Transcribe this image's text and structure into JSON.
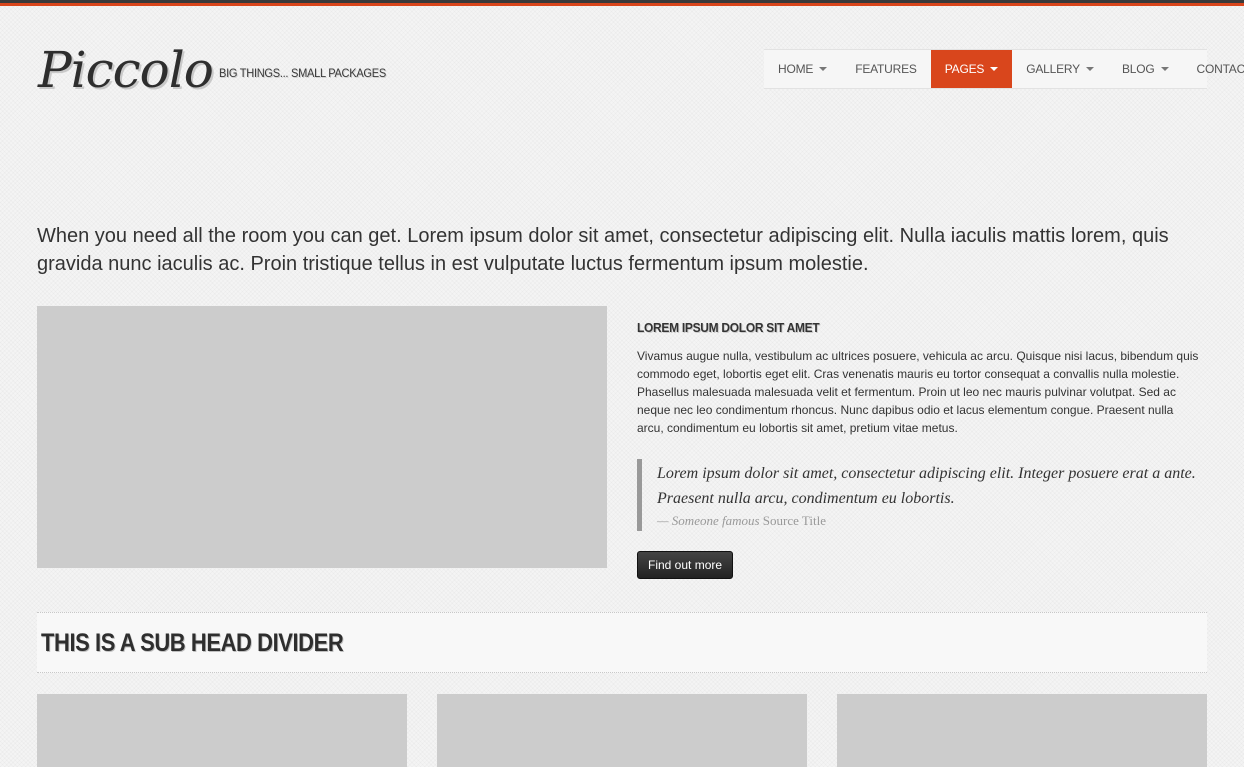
{
  "brand": {
    "logo": "Piccolo",
    "tagline": "BIG THINGS... SMALL PACKAGES",
    "accent_color": "#d9461c"
  },
  "nav": {
    "items": [
      {
        "label": "HOME",
        "dropdown": true,
        "active": false
      },
      {
        "label": "FEATURES",
        "dropdown": false,
        "active": false
      },
      {
        "label": "PAGES",
        "dropdown": true,
        "active": true
      },
      {
        "label": "GALLERY",
        "dropdown": true,
        "active": false
      },
      {
        "label": "BLOG",
        "dropdown": true,
        "active": false
      },
      {
        "label": "CONTACT",
        "dropdown": false,
        "active": false
      }
    ]
  },
  "lead": "When you need all the room you can get. Lorem ipsum dolor sit amet, consectetur adipiscing elit. Nulla iaculis mattis lorem, quis gravida nunc iaculis ac. Proin tristique tellus in est vulputate luctus fermentum ipsum molestie.",
  "feature": {
    "heading": "LOREM IPSUM DOLOR SIT AMET",
    "body": "Vivamus augue nulla, vestibulum ac ultrices posuere, vehicula ac arcu. Quisque nisi lacus, bibendum quis commodo eget, lobortis eget elit. Cras venenatis mauris eu tortor consequat a convallis nulla molestie. Phasellus malesuada malesuada velit et fermentum. Proin ut leo nec mauris pulvinar volutpat. Sed ac neque nec leo condimentum rhoncus. Nunc dapibus odio et lacus elementum congue. Praesent nulla arcu, condimentum eu lobortis sit amet, pretium vitae metus.",
    "quote": {
      "text": "Lorem ipsum dolor sit amet, consectetur adipiscing elit. Integer posuere erat a ante. Praesent nulla arcu, condimentum eu lobortis.",
      "author": "— Someone famous",
      "source": "Source Title"
    },
    "button": "Find out more"
  },
  "divider": {
    "title": "THIS IS A SUB HEAD DIVIDER"
  }
}
